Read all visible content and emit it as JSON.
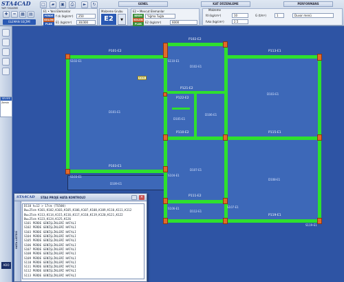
{
  "app": {
    "title": "STA4CAD",
    "subtitle": "YAPI TASARIM"
  },
  "toolbar": {
    "element_button": "ELEMAN SEÇİMİ"
  },
  "tabs": [
    {
      "label": "GENEL"
    },
    {
      "label": "KAT DÜZENLEME"
    },
    {
      "label": "PERFORMANS"
    }
  ],
  "panel1": {
    "header": "E1 • Yeni Elemanlar",
    "materials": [
      "PERDE",
      "KOLON",
      "PLAK"
    ],
    "fck_label": "f ck (kg/cm²)",
    "fck_value": "250",
    "e1_label": "E1 (kg/cm²)",
    "e1_value": "30/300"
  },
  "panel_mid": {
    "header": "Malzeme Grubu",
    "value": "E2"
  },
  "panel2": {
    "header": "E2 • Mevcut Elemanlar",
    "materials": [
      "BİRİM",
      "KOLON",
      "PLAK"
    ],
    "dropdown_value": "Yığma Tuğla",
    "e2_label": "E2 (kg/cm²)",
    "e2_value": "6000"
  },
  "panel3": {
    "g_label": "fd (kg/cm²)",
    "g_value": "10",
    "malzeme_label": "Malzeme",
    "fvko_label": "fvko (kg/cm²)",
    "fvko_value": "2.5",
    "g_tm_label": "G (t/m²)",
    "g_tm_value": "1",
    "menu_value": "Duvar menü"
  },
  "plan": {
    "slab_labels": [
      "D101-E1",
      "D102-E1",
      "D103-E1",
      "D105-E1",
      "D106-E1",
      "D107-E1",
      "D108-E1",
      "D109-E1",
      "D110-E1",
      "D111-E1",
      "D112-E1"
    ],
    "beam_labels": [
      "P101-E2",
      "P102-E2",
      "P103-E1",
      "P104-E1",
      "P105-E2",
      "P106-E2",
      "P107-E2",
      "P108-E1",
      "P109-E1",
      "P110-E2",
      "P111-E2",
      "P112-E2",
      "P113-E1",
      "P114-E1",
      "P115-E1",
      "P116-E1",
      "P117-E1",
      "P118-E2",
      "P119-E1",
      "P120-E2",
      "P121-E2",
      "P122-E2"
    ],
    "column_labels": [
      "S101-E1",
      "S102-E1",
      "S103-E1",
      "S104-E1",
      "S105-E1",
      "S106-E1",
      "S107-E1",
      "S108-E1",
      "S109-E1",
      "S110-E1",
      "S111-E1",
      "S112-E1",
      "S113-E1",
      "S114-E1",
      "S115-E1",
      "S116-E1",
      "S117-E1",
      "S118-E1",
      "S119-E1",
      "S120-E1"
    ],
    "tag": "S101"
  },
  "dialog": {
    "logo": "STA4CAD",
    "title": "STA4 PROJE HATA KONTROLÜ",
    "side_label": "HATA LİSTESİ",
    "lines": [
      "D110 h=12 > 17cm  (TS500)",
      "Bw=25cm K101,K102,K103,K105,K106,K107,K108,K109,K110,K111,K112",
      "Bw=25cm K113,K114,K115,K116,K117,K118,K119,K120,K121,K122",
      "Bw=25cm K123,K124,K125,K126",
      "S101 PERDE GENİŞLİKLERİ HATALI",
      "S102 PERDE GENİŞLİKLERİ HATALI",
      "S103 PERDE GENİŞLİKLERİ HATALI",
      "S104 PERDE GENİŞLİKLERİ HATALI",
      "S105 PERDE GENİŞLİKLERİ HATALI",
      "S106 PERDE GENİŞLİKLERİ HATALI",
      "S107 PERDE GENİŞLİKLERİ HATALI",
      "S108 PERDE GENİŞLİKLERİ HATALI",
      "S109 PERDE GENİŞLİKLERİ HATALI",
      "S110 PERDE GENİŞLİKLERİ HATALI",
      "S111 PERDE GENİŞLİKLERİ HATALI",
      "S112 PERDE GENİŞLİKLERİ HATALI",
      "S113 PERDE GENİŞLİKLERİ HATALI"
    ]
  },
  "sidepanel": {
    "header": "SEVİYE",
    "value": "Zemin"
  },
  "status": {
    "label": "ADO"
  },
  "colors": {
    "beam": "#2ee02e",
    "column": "#e26a2a",
    "slab": "#3d68b8",
    "accent": "#2a59b3"
  }
}
